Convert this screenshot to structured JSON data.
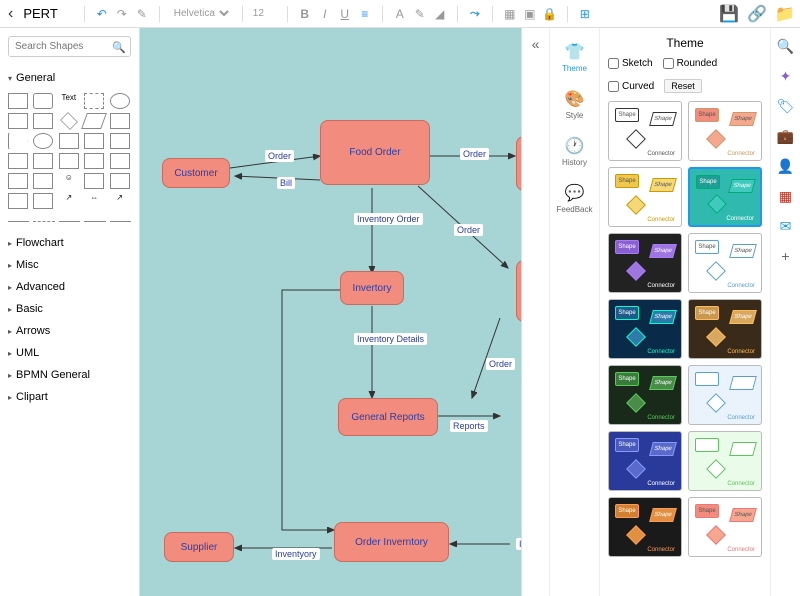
{
  "title": "PERT",
  "toolbar": {
    "font": "Helvetica",
    "size": "12"
  },
  "search": {
    "placeholder": "Search Shapes"
  },
  "categories": {
    "general": "General",
    "flowchart": "Flowchart",
    "misc": "Misc",
    "advanced": "Advanced",
    "basic": "Basic",
    "arrows": "Arrows",
    "uml": "UML",
    "bpmn": "BPMN General",
    "clipart": "Clipart"
  },
  "nodes": {
    "customer": "Customer",
    "food_order": "Food Order",
    "inventory": "Invertory",
    "general_reports": "General Reports",
    "order_inventory": "Order Inverntory",
    "supplier": "Supplier"
  },
  "edges": {
    "order1": "Order",
    "order2": "Order",
    "order3": "Order",
    "order4": "Order",
    "bill": "Bill",
    "inv_order": "Inventory Order",
    "inv_details": "Inventory Details",
    "reports": "Reports",
    "inventyory": "Inventyory",
    "ir": "Ir"
  },
  "side_tabs": {
    "theme": "Theme",
    "style": "Style",
    "history": "History",
    "feedback": "FeedBack"
  },
  "theme_panel": {
    "title": "Theme",
    "sketch": "Sketch",
    "rounded": "Rounded",
    "curved": "Curved",
    "reset": "Reset",
    "shape": "Shape",
    "connector": "Connector"
  },
  "theme_colors": [
    {
      "bg": "#ffffff",
      "s1": "#fff",
      "s2": "#fff",
      "s3": "#fff",
      "b": "#333",
      "tc": "#555"
    },
    {
      "bg": "#ffffff",
      "s1": "#f18c7e",
      "s2": "#f5a78f",
      "s3": "#f5a78f",
      "b": "#c96",
      "tc": "#c96"
    },
    {
      "bg": "#ffffff",
      "s1": "#f0c850",
      "s2": "#f5d878",
      "s3": "#f5d878",
      "b": "#c90",
      "tc": "#c90"
    },
    {
      "bg": "#2fb9af",
      "s1": "#1e9e94",
      "s2": "#3fc9bf",
      "s3": "#3fc9bf",
      "b": "#0a7",
      "tc": "#fff",
      "sel": true
    },
    {
      "bg": "#222222",
      "s1": "#8a5fd0",
      "s2": "#9f75e0",
      "s3": "#9f75e0",
      "b": "#a7f",
      "tc": "#fff"
    },
    {
      "bg": "#ffffff",
      "s1": "#fff",
      "s2": "#fff",
      "s3": "#fff",
      "b": "#5a9ed6",
      "tc": "#5a9ed6"
    },
    {
      "bg": "#0a2a4a",
      "s1": "#1e5a8a",
      "s2": "#2f7aaa",
      "s3": "#2f7aaa",
      "b": "#0fc",
      "tc": "#0fc"
    },
    {
      "bg": "#3a2a1a",
      "s1": "#c99850",
      "s2": "#d9a860",
      "s3": "#d9a860",
      "b": "#fb5",
      "tc": "#fb5"
    },
    {
      "bg": "#1a2a1a",
      "s1": "#3a7a3a",
      "s2": "#4a8a4a",
      "s3": "#4a8a4a",
      "b": "#5c5",
      "tc": "#5c5"
    },
    {
      "bg": "#eaf3fb",
      "s1": "#fff",
      "s2": "#fff",
      "s3": "#fff",
      "b": "#5a9ed6",
      "tc": "#5a9ed6"
    },
    {
      "bg": "#2a3a9a",
      "s1": "#4a5aba",
      "s2": "#5a6aca",
      "s3": "#5a6aca",
      "b": "#89f",
      "tc": "#fff"
    },
    {
      "bg": "#eafbea",
      "s1": "#fff",
      "s2": "#fff",
      "s3": "#fff",
      "b": "#5ac65a",
      "tc": "#5ac65a"
    },
    {
      "bg": "#1a1a1a",
      "s1": "#d08030",
      "s2": "#e09040",
      "s3": "#e09040",
      "b": "#f95",
      "tc": "#f95"
    },
    {
      "bg": "#ffffff",
      "s1": "#f18c7e",
      "s2": "#f5a78f",
      "s3": "#f5a78f",
      "b": "#e77",
      "tc": "#e77"
    }
  ]
}
